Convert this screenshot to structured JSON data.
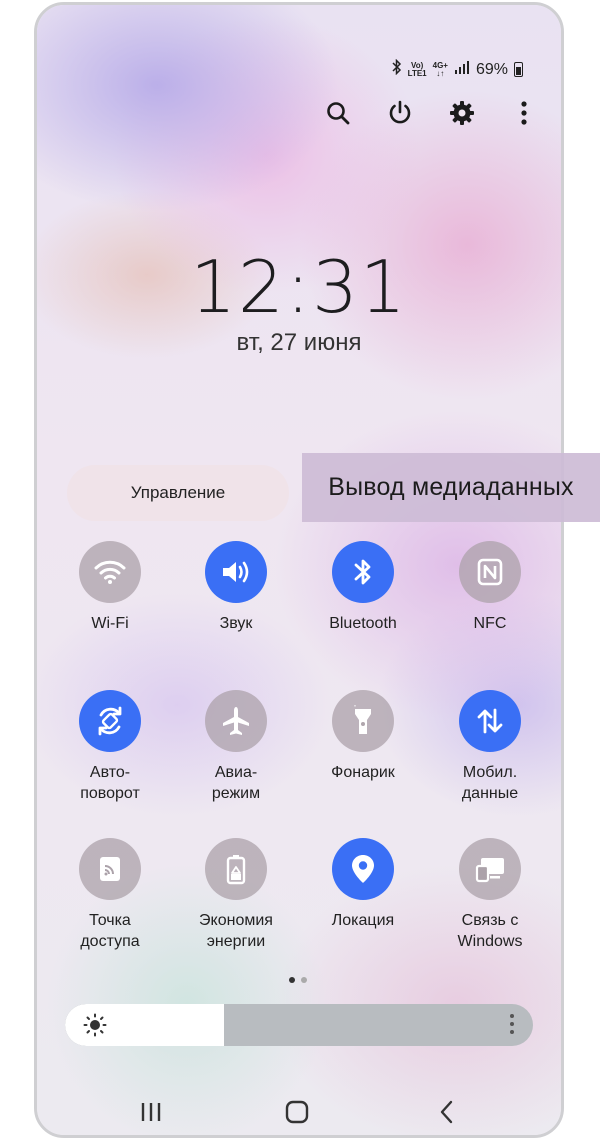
{
  "status_bar": {
    "signal_top": "Vo)",
    "signal_bottom": "LTE1",
    "net_top": "4G+",
    "net_bottom": "↓↑",
    "battery": "69%"
  },
  "top_actions": [
    "search-icon",
    "power-icon",
    "gear-icon",
    "more-vert-icon"
  ],
  "clock": {
    "time": "12:31",
    "date": "вт, 27 июня"
  },
  "tabs": {
    "control": "Управление",
    "media_output": "Вывод медиаданных"
  },
  "tiles": [
    {
      "label": "Wi-Fi",
      "active": false,
      "icon": "wifi-icon"
    },
    {
      "label": "Звук",
      "active": true,
      "icon": "volume-icon"
    },
    {
      "label": "Bluetooth",
      "active": true,
      "icon": "bluetooth-icon"
    },
    {
      "label": "NFC",
      "active": false,
      "icon": "nfc-icon"
    },
    {
      "label": "Авто-\nповорот",
      "active": true,
      "icon": "auto-rotate-icon"
    },
    {
      "label": "Авиа-\nрежим",
      "active": false,
      "icon": "airplane-icon"
    },
    {
      "label": "Фонарик",
      "active": false,
      "icon": "flashlight-icon"
    },
    {
      "label": "Мобил.\nданные",
      "active": true,
      "icon": "mobile-data-icon"
    },
    {
      "label": "Точка\nдоступа",
      "active": false,
      "icon": "hotspot-icon"
    },
    {
      "label": "Экономия\nэнергии",
      "active": false,
      "icon": "battery-saver-icon"
    },
    {
      "label": "Локация",
      "active": true,
      "icon": "location-icon"
    },
    {
      "label": "Связь с\nWindows",
      "active": false,
      "icon": "link-windows-icon"
    }
  ],
  "colors": {
    "active": "#3a6ff5",
    "inactive": "#aca2aa"
  },
  "pager": {
    "current": 1,
    "total": 2
  },
  "brightness": {
    "level": 0.34
  }
}
